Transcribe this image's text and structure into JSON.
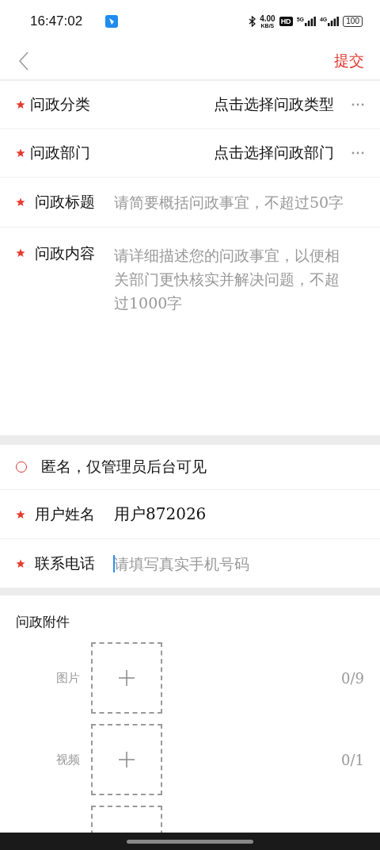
{
  "status_bar": {
    "time": "16:47:02",
    "net_speed": "4.00",
    "net_unit": "KB/S",
    "hd": "HD",
    "signals": [
      "5G",
      "4G"
    ],
    "battery": "100"
  },
  "header": {
    "submit": "提交"
  },
  "form": [
    {
      "kind": "select",
      "label": "问政分类",
      "required": true,
      "value": "点击选择问政类型"
    },
    {
      "kind": "select",
      "label": "问政部门",
      "required": true,
      "value": "点击选择问政部门"
    },
    {
      "kind": "input",
      "label": "问政标题",
      "required": true,
      "placeholder": "请简要概括问政事宜，不超过50字"
    },
    {
      "kind": "textarea",
      "label": "问政内容",
      "required": true,
      "placeholder": "请详细描述您的问政事宜，以便相关部门更快核实并解决问题，不超过1000字"
    }
  ],
  "anonymous": {
    "label": "匿名，仅管理员后台可见",
    "checked": false
  },
  "contact": [
    {
      "kind": "value",
      "label": "用户姓名",
      "required": true,
      "value": "用户872026"
    },
    {
      "kind": "input",
      "label": "联系电话",
      "required": true,
      "placeholder": "请填写真实手机号码",
      "focused": true
    }
  ],
  "attachments": {
    "title": "问政附件",
    "items": [
      {
        "kind": "full",
        "label": "图片",
        "count": "0/9"
      },
      {
        "kind": "full",
        "label": "视频",
        "count": "0/1"
      },
      {
        "kind": "cut"
      }
    ]
  }
}
